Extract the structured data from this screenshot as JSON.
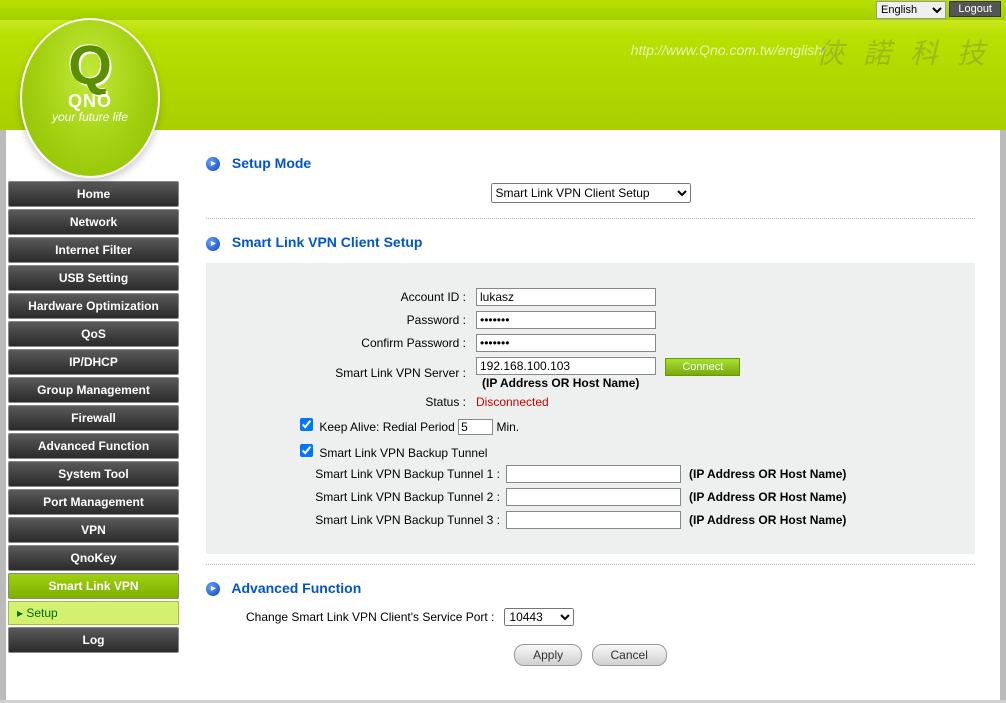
{
  "top": {
    "language": "English",
    "logout": "Logout"
  },
  "header": {
    "url": "http://www.Qno.com.tw/english/",
    "brand_cjk": "俠 諾 科 技",
    "logo_name": "QNO",
    "logo_tag": "your future life"
  },
  "nav": {
    "items": [
      "Home",
      "Network",
      "Internet Filter",
      "USB Setting",
      "Hardware Optimization",
      "QoS",
      "IP/DHCP",
      "Group Management",
      "Firewall",
      "Advanced Function",
      "System Tool",
      "Port Management",
      "VPN",
      "QnoKey",
      "Smart Link VPN"
    ],
    "active_index": 14,
    "sub_item": "Setup",
    "after_items": [
      "Log"
    ]
  },
  "sections": {
    "setup_mode": "Setup Mode",
    "client_setup": "Smart Link VPN Client Setup",
    "advanced": "Advanced Function"
  },
  "mode_select": "Smart Link VPN Client Setup",
  "form": {
    "account_label": "Account ID :",
    "account_value": "lukasz",
    "password_label": "Password :",
    "password_value": "•••••••",
    "confirm_label": "Confirm Password :",
    "confirm_value": "•••••••",
    "server_label": "Smart Link VPN Server :",
    "server_value": "192.168.100.103",
    "server_hint": "(IP Address OR Host Name)",
    "connect": "Connect",
    "status_label": "Status :",
    "status_value": "Disconnected",
    "keepalive_pre": "Keep Alive: Redial Period",
    "keepalive_value": "5",
    "keepalive_post": "Min.",
    "backup_toggle": "Smart Link VPN Backup Tunnel",
    "backup1_label": "Smart Link VPN Backup Tunnel 1 :",
    "backup2_label": "Smart Link VPN Backup Tunnel 2 :",
    "backup3_label": "Smart Link VPN Backup Tunnel 3 :",
    "backup_hint": "(IP Address OR Host Name)",
    "backup1_value": "",
    "backup2_value": "",
    "backup3_value": ""
  },
  "advanced": {
    "port_label": "Change Smart Link VPN Client's Service Port :",
    "port_value": "10443"
  },
  "buttons": {
    "apply": "Apply",
    "cancel": "Cancel"
  }
}
